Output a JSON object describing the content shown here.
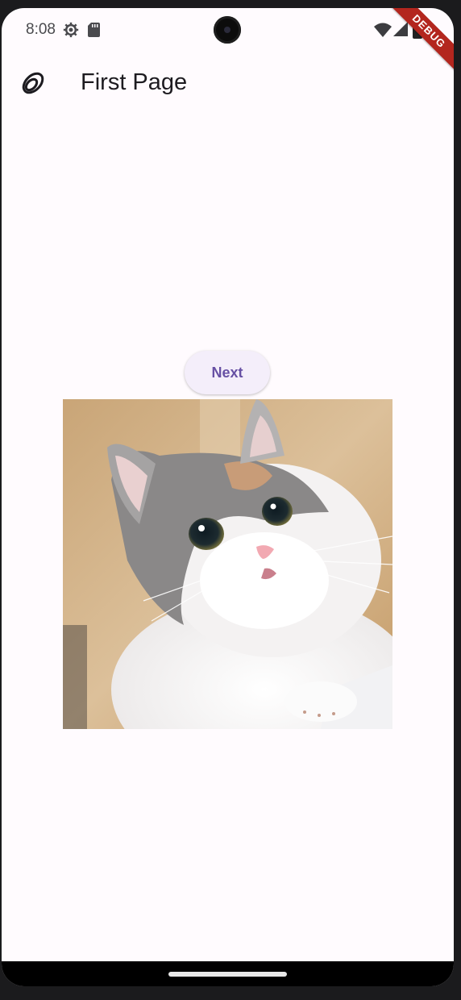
{
  "status_bar": {
    "time": "8:08",
    "icons": [
      "gear-icon",
      "sd-card-icon",
      "wifi-icon",
      "signal-icon",
      "battery-icon"
    ]
  },
  "debug_banner": "DEBUG",
  "app_bar": {
    "icon": "rings-icon",
    "title": "First Page"
  },
  "content": {
    "button_label": "Next",
    "image": "cat-photo"
  },
  "colors": {
    "background": "#fffbfe",
    "button_bg": "#f4eefa",
    "button_text": "#6750a4",
    "debug_banner": "#b3261e"
  }
}
